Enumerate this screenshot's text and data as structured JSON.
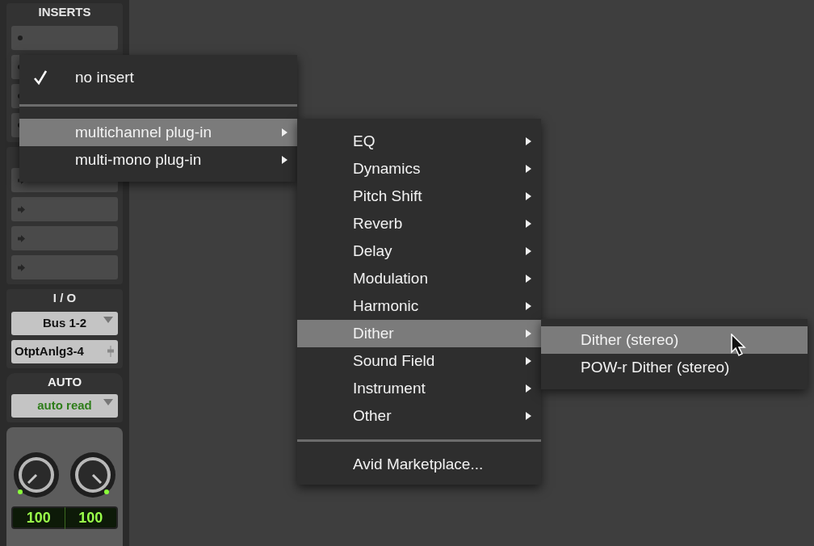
{
  "channel_strip": {
    "inserts_title": "INSERTS",
    "io_title": "I / O",
    "input": "Bus 1-2",
    "output": "OtptAnlg3-4",
    "auto_title": "AUTO",
    "auto_mode": "auto read",
    "pan_readouts": [
      "100",
      "100"
    ]
  },
  "menus": [
    {
      "items": [
        {
          "kind": "item",
          "label": "no insert",
          "checked": true,
          "selected": false,
          "has_submenu": false
        },
        {
          "kind": "separator"
        },
        {
          "kind": "item",
          "label": "multichannel plug-in",
          "checked": false,
          "selected": true,
          "has_submenu": true
        },
        {
          "kind": "item",
          "label": "multi-mono plug-in",
          "checked": false,
          "selected": false,
          "has_submenu": true
        }
      ]
    },
    {
      "items": [
        {
          "kind": "item",
          "label": "EQ",
          "selected": false,
          "has_submenu": true
        },
        {
          "kind": "item",
          "label": "Dynamics",
          "selected": false,
          "has_submenu": true
        },
        {
          "kind": "item",
          "label": "Pitch Shift",
          "selected": false,
          "has_submenu": true
        },
        {
          "kind": "item",
          "label": "Reverb",
          "selected": false,
          "has_submenu": true
        },
        {
          "kind": "item",
          "label": "Delay",
          "selected": false,
          "has_submenu": true
        },
        {
          "kind": "item",
          "label": "Modulation",
          "selected": false,
          "has_submenu": true
        },
        {
          "kind": "item",
          "label": "Harmonic",
          "selected": false,
          "has_submenu": true
        },
        {
          "kind": "item",
          "label": "Dither",
          "selected": true,
          "has_submenu": true
        },
        {
          "kind": "item",
          "label": "Sound Field",
          "selected": false,
          "has_submenu": true
        },
        {
          "kind": "item",
          "label": "Instrument",
          "selected": false,
          "has_submenu": true
        },
        {
          "kind": "item",
          "label": "Other",
          "selected": false,
          "has_submenu": true
        },
        {
          "kind": "separator"
        },
        {
          "kind": "item",
          "label": "Avid Marketplace...",
          "selected": false,
          "has_submenu": false
        }
      ]
    },
    {
      "items": [
        {
          "kind": "item",
          "label": "Dither (stereo)",
          "selected": true,
          "has_submenu": false
        },
        {
          "kind": "item",
          "label": "POW-r Dither (stereo)",
          "selected": false,
          "has_submenu": false
        }
      ]
    }
  ]
}
